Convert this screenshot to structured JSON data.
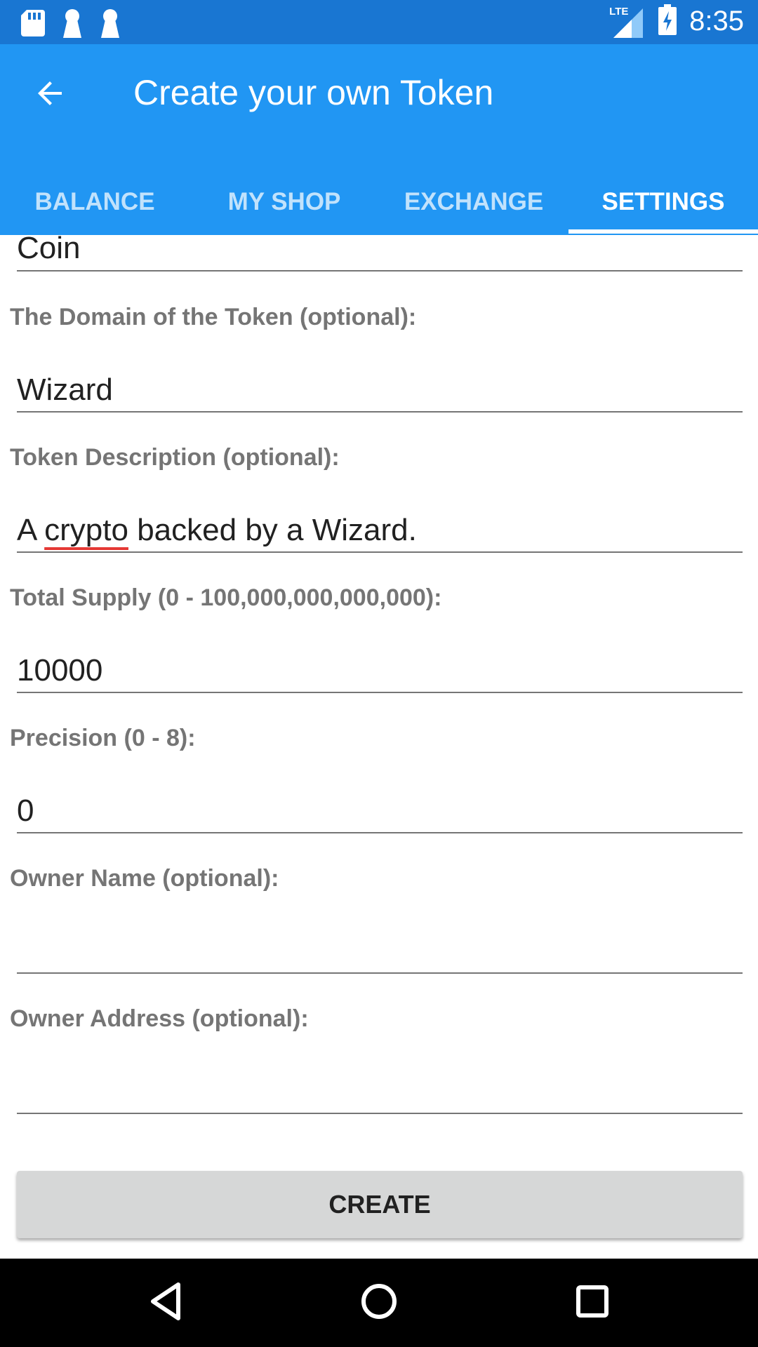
{
  "status_bar": {
    "network": "LTE",
    "time": "8:35",
    "icons": [
      "sd-card-icon",
      "keyhole-icon",
      "keyhole-icon",
      "signal-icon",
      "battery-charging-icon"
    ]
  },
  "app_bar": {
    "title": "Create your own Token",
    "back_icon": "arrow-left-icon"
  },
  "tabs": [
    {
      "label": "BALANCE"
    },
    {
      "label": "MY SHOP"
    },
    {
      "label": "EXCHANGE"
    },
    {
      "label": "SETTINGS",
      "active": true
    }
  ],
  "form": {
    "token_name_value": "Coin",
    "domain_label": "The Domain of the Token (optional):",
    "domain_value": "Wizard",
    "description_label": "Token Description (optional):",
    "description_value_a": "A ",
    "description_value_misspelled": "crypto",
    "description_value_b": " backed by a Wizard.",
    "supply_label": "Total Supply (0 - 100,000,000,000,000):",
    "supply_value": "10000",
    "precision_label": "Precision (0 - 8):",
    "precision_value": "0",
    "owner_name_label": "Owner Name (optional):",
    "owner_name_value": "",
    "owner_address_label": "Owner Address (optional):",
    "owner_address_value": ""
  },
  "create_button": "CREATE",
  "nav_bar": {
    "back_icon": "triangle-back-icon",
    "home_icon": "circle-home-icon",
    "recents_icon": "square-recents-icon"
  },
  "colors": {
    "status_bar": "#1976d2",
    "app_bar": "#2196f3",
    "button_bg": "#d6d7d7",
    "spell_error": "#e53935"
  }
}
